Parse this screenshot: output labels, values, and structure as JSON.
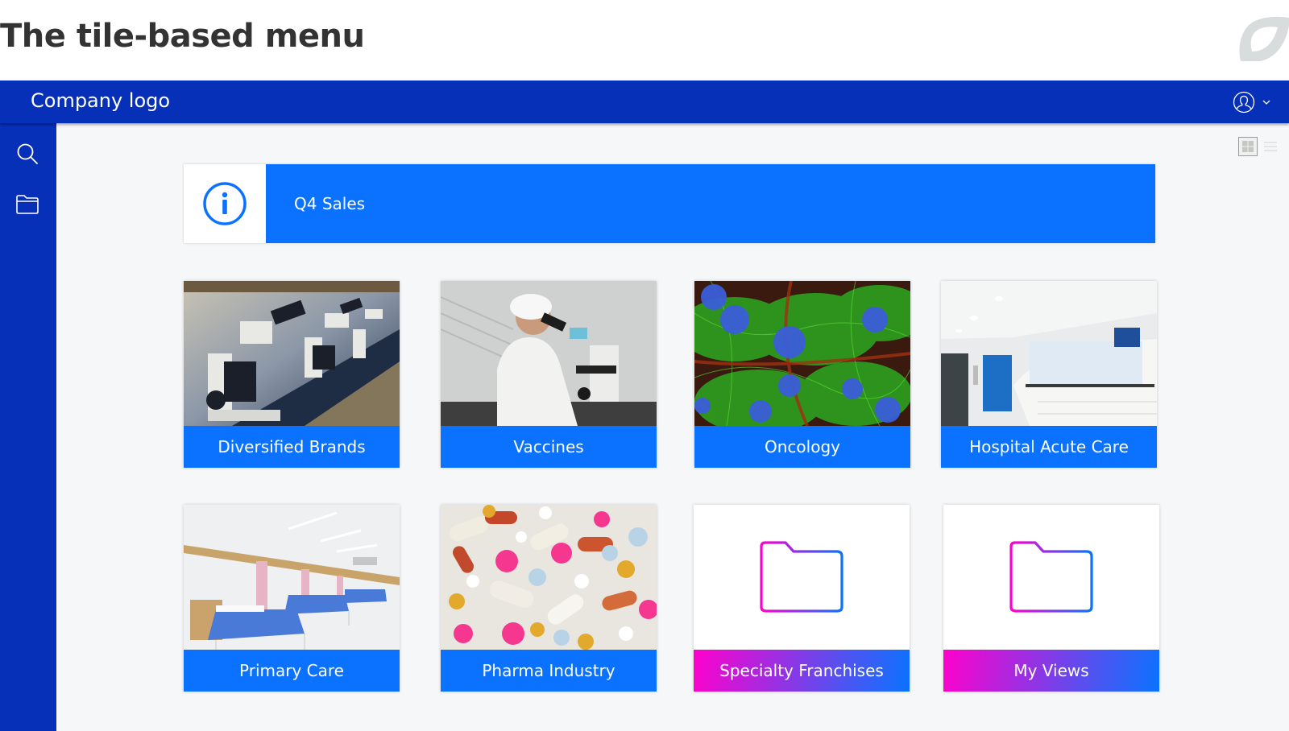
{
  "page": {
    "title": "The tile-based menu",
    "brand_mark_icon": "leaf-logo-icon"
  },
  "header": {
    "company_logo": "Company logo",
    "user_icon": "user-avatar-icon",
    "user_menu_chevron": "chevron-down-icon"
  },
  "sidebar": {
    "items": [
      {
        "name": "search",
        "icon": "search-icon"
      },
      {
        "name": "folders",
        "icon": "folder-icon"
      }
    ]
  },
  "view_toggle": {
    "options": [
      {
        "name": "grid",
        "icon": "grid-view-icon",
        "selected": true
      },
      {
        "name": "list",
        "icon": "list-view-icon",
        "selected": false
      }
    ]
  },
  "banner": {
    "icon": "info-icon",
    "label": "Q4 Sales",
    "color": "#0a72ff"
  },
  "tiles": [
    {
      "label": "Diversified Brands",
      "image": "microscopes-photo",
      "style": "photo"
    },
    {
      "label": "Vaccines",
      "image": "scientist-microscope-photo",
      "style": "photo"
    },
    {
      "label": "Oncology",
      "image": "fluorescent-cells-photo",
      "style": "photo"
    },
    {
      "label": "Hospital Acute Care",
      "image": "hospital-reception-photo",
      "style": "photo"
    },
    {
      "label": "Primary Care",
      "image": "hospital-ward-photo",
      "style": "photo"
    },
    {
      "label": "Pharma Industry",
      "image": "pills-photo",
      "style": "photo"
    },
    {
      "label": "Specialty Franchises",
      "image": "folder-icon",
      "style": "folder"
    },
    {
      "label": "My Views",
      "image": "folder-icon",
      "style": "folder"
    }
  ],
  "colors": {
    "header_blue": "#0730b8",
    "accent_blue": "#0a72ff",
    "gradient_pink": "#ff00cc",
    "background": "#f6f7f9",
    "title_text": "#333333"
  }
}
